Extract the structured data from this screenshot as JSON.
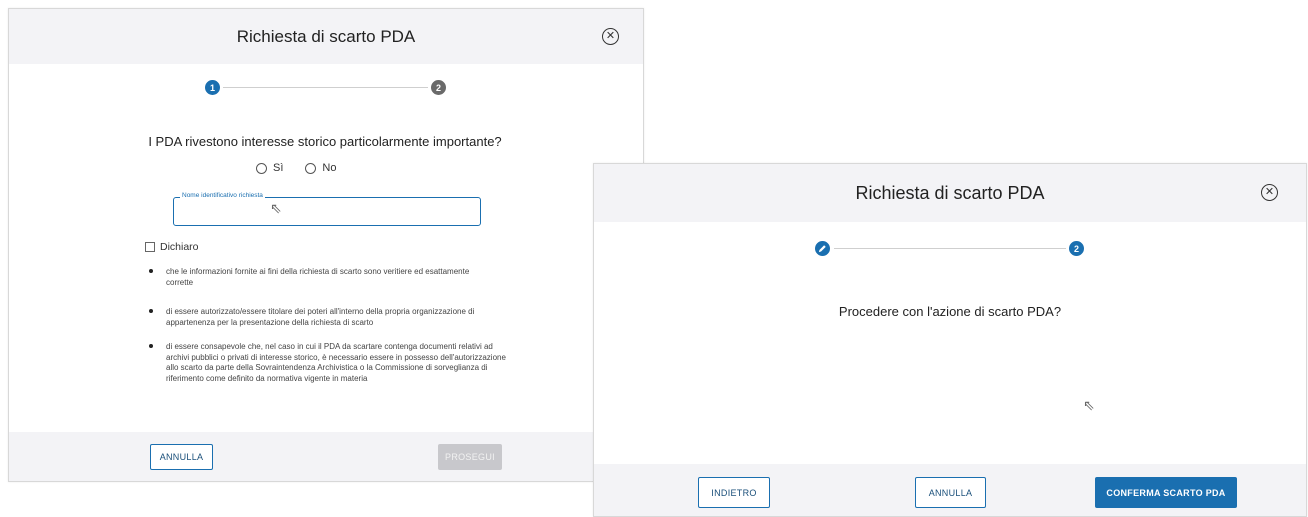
{
  "dialog_left": {
    "title": "Richiesta di scarto PDA",
    "close_icon": "close-circle-icon",
    "steps": [
      "1",
      "2"
    ],
    "question": "I PDA rivestono interesse storico particolarmente importante?",
    "radio_si": "Sì",
    "radio_no": "No",
    "input_label": "Nome identificativo richiesta",
    "input_value": "",
    "checkbox_label": "Dichiaro",
    "bullets": [
      "che le informazioni fornite ai fini della richiesta di scarto sono veritiere ed esattamente corrette",
      "di essere autorizzato/essere titolare dei poteri all'interno della propria organizzazione di appartenenza per la presentazione della richiesta di scarto",
      "di essere consapevole che, nel caso in cui il PDA da scartare contenga documenti relativi ad archivi pubblici o privati di interesse storico, è necessario essere in possesso dell'autorizzazione allo scarto da parte della Sovraintendenza Archivistica o la Commissione di sorveglianza di riferimento come definito da normativa vigente in materia"
    ],
    "cancel_label": "ANNULLA",
    "next_label": "PROSEGUI"
  },
  "dialog_right": {
    "title": "Richiesta di scarto PDA",
    "close_icon": "close-circle-icon",
    "step1_icon": "pencil-icon",
    "step2": "2",
    "question": "Procedere con l'azione di scarto PDA?",
    "back_label": "INDIETRO",
    "cancel_label": "ANNULLA",
    "confirm_label": "CONFERMA SCARTO PDA"
  }
}
